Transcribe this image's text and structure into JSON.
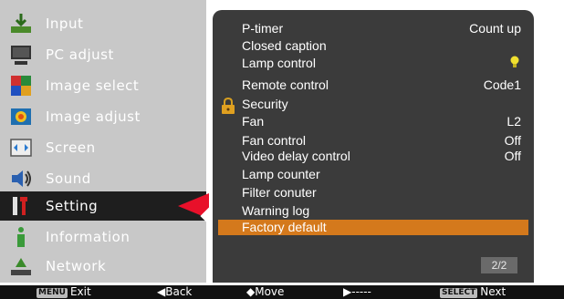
{
  "left_menu": {
    "items": [
      {
        "label": "Input",
        "icon": "input-icon"
      },
      {
        "label": "PC adjust",
        "icon": "pc-adjust-icon"
      },
      {
        "label": "Image select",
        "icon": "image-select-icon"
      },
      {
        "label": "Image adjust",
        "icon": "image-adjust-icon"
      },
      {
        "label": "Screen",
        "icon": "screen-icon"
      },
      {
        "label": "Sound",
        "icon": "sound-icon"
      },
      {
        "label": "Setting",
        "icon": "setting-icon",
        "selected": true
      },
      {
        "label": "Information",
        "icon": "information-icon"
      },
      {
        "label": "Network",
        "icon": "network-icon"
      }
    ]
  },
  "settings_panel": {
    "rows": [
      {
        "name": "P-timer",
        "value": "Count up"
      },
      {
        "name": "Closed caption",
        "value": ""
      },
      {
        "name": "Lamp control",
        "value": ""
      },
      {
        "name": "Remote control",
        "value": "Code1"
      },
      {
        "name": "Security",
        "value": ""
      },
      {
        "name": "Fan",
        "value": "L2"
      },
      {
        "name": "Fan control",
        "value": "Off"
      },
      {
        "name": "Video delay control",
        "value": "Off"
      },
      {
        "name": "Lamp counter",
        "value": ""
      },
      {
        "name": "Filter conuter",
        "value": ""
      },
      {
        "name": "Warning log",
        "value": ""
      },
      {
        "name": "Factory default",
        "value": ""
      }
    ],
    "page": "2/2"
  },
  "bottom_bar": {
    "menu_key": "MENU",
    "menu_label": "Exit",
    "back_label": "Back",
    "move_label": "Move",
    "right_label": "-----",
    "select_key": "SELECT",
    "next_label": "Next"
  },
  "colors": {
    "menu_bg": "#c8c8c8",
    "panel_bg": "#3b3b3b",
    "highlight": "#d4791c",
    "arrow": "#e8102a",
    "selected_bg": "#1e1e1e"
  }
}
